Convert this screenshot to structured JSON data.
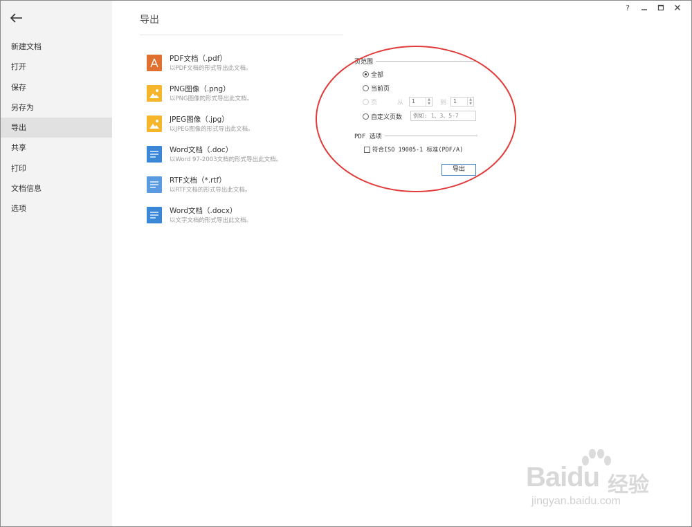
{
  "window": {
    "controls": [
      "?",
      "—",
      "□",
      "✕"
    ]
  },
  "sidebar": {
    "items": [
      {
        "label": "新建文档"
      },
      {
        "label": "打开"
      },
      {
        "label": "保存"
      },
      {
        "label": "另存为"
      },
      {
        "label": "导出",
        "active": true
      },
      {
        "label": "共享"
      },
      {
        "label": "打印"
      },
      {
        "label": "文档信息"
      },
      {
        "label": "选项"
      }
    ]
  },
  "main": {
    "title": "导出",
    "formats": [
      {
        "name": "PDF文档（.pdf）",
        "desc": "以PDF文档的形式导出此文档。",
        "icon": "pdf-icon",
        "color": "#e0702f"
      },
      {
        "name": "PNG图像（.png）",
        "desc": "以PNG图像的形式导出此文档。",
        "icon": "image-icon",
        "color": "#f7b52c"
      },
      {
        "name": "JPEG图像（.jpg）",
        "desc": "以JPEG图像的形式导出此文档。",
        "icon": "image-icon",
        "color": "#f7b52c"
      },
      {
        "name": "Word文档（.doc）",
        "desc": "以Word 97-2003文档的形式导出此文档。",
        "icon": "word-icon",
        "color": "#3a87d8"
      },
      {
        "name": "RTF文档（*.rtf）",
        "desc": "以RTF文档的形式导出此文档。",
        "icon": "rtf-icon",
        "color": "#5a9ae0"
      },
      {
        "name": "Word文档（.docx）",
        "desc": "以文字文档的形式导出此文档。",
        "icon": "word-icon",
        "color": "#3a87d8"
      }
    ]
  },
  "options": {
    "range_legend": "页范围",
    "all_label": "全部",
    "current_label": "当前页",
    "pages_label": "页",
    "from_label": "从",
    "to_label": "到",
    "from_value": "1",
    "to_value": "1",
    "custom_label": "自定义页数",
    "custom_placeholder": "例如: 1、3、5-7",
    "pdf_legend": "PDF 选项",
    "pdfa_label": "符合ISO 19005-1 标准(PDF/A)",
    "export_button": "导出"
  },
  "watermark": {
    "brand": "Baidu",
    "cn": "经验",
    "url": "jingyan.baidu.com"
  },
  "colors": {
    "highlight_circle": "#e23a3a",
    "button_border": "#3c7fc4",
    "sidebar_bg": "#f3f3f3",
    "sidebar_active": "#e1e1e1"
  }
}
